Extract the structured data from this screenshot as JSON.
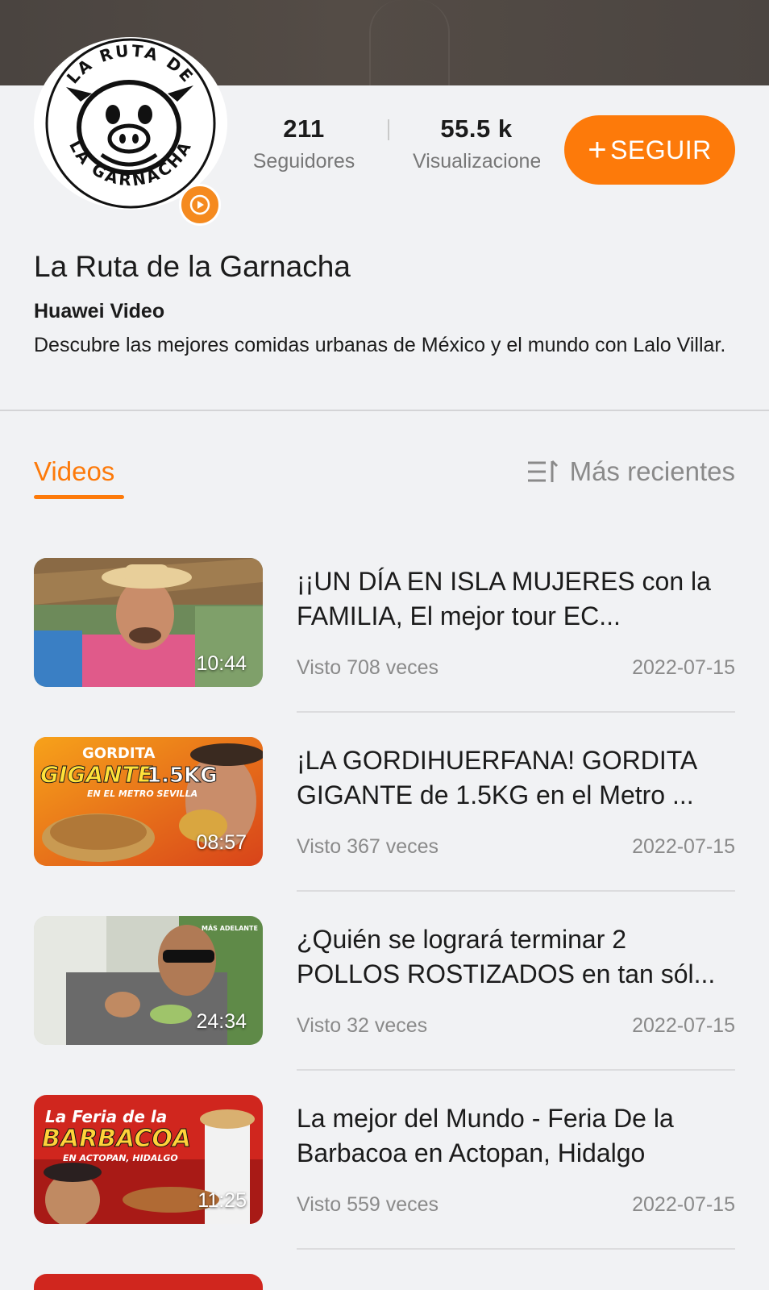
{
  "channel": {
    "name": "La Ruta de la Garnacha",
    "provider": "Huawei Video",
    "description": "Descubre las mejores comidas urbanas de México y el mundo con Lalo Villar.",
    "logo_text_top": "LA RUTA DE",
    "logo_text_bottom": "LA GARNACHA"
  },
  "stats": {
    "followers_value": "211",
    "followers_label": "Seguidores",
    "views_value": "55.5 k",
    "views_label": "Visualizaciones"
  },
  "follow_button": {
    "plus": "+",
    "label": "SEGUIR"
  },
  "tabs": {
    "videos_label": "Videos",
    "sort_label": "Más recientes"
  },
  "colors": {
    "accent": "#fd7a0a",
    "banner": "#4e4743",
    "background": "#f1f2f4"
  },
  "videos": [
    {
      "title": "¡¡UN DÍA EN ISLA MUJERES con la FAMILIA, El mejor tour EC...",
      "views": "Visto 708 veces",
      "date": "2022-07-15",
      "duration": "10:44"
    },
    {
      "title": "¡LA GORDIHUERFANA! GORDITA GIGANTE de 1.5KG en el Metro ...",
      "views": "Visto 367 veces",
      "date": "2022-07-15",
      "duration": "08:57",
      "thumb_text_1": "GORDITA",
      "thumb_text_2": "GIGANTE",
      "thumb_text_3": "1.5KG",
      "thumb_text_4": "EN EL METRO SEVILLA"
    },
    {
      "title": "¿Quién se logrará terminar 2 POLLOS ROSTIZADOS en tan sól...",
      "views": "Visto 32 veces",
      "date": "2022-07-15",
      "duration": "24:34",
      "thumb_text_1": "MÁS ADELANTE"
    },
    {
      "title": "La mejor del Mundo - Feria De la Barbacoa en Actopan, Hidalgo",
      "views": "Visto 559 veces",
      "date": "2022-07-15",
      "duration": "11:25",
      "thumb_text_1": "La Feria de la",
      "thumb_text_2": "BARBACOA",
      "thumb_text_3": "EN ACTOPAN, HIDALGO"
    }
  ]
}
